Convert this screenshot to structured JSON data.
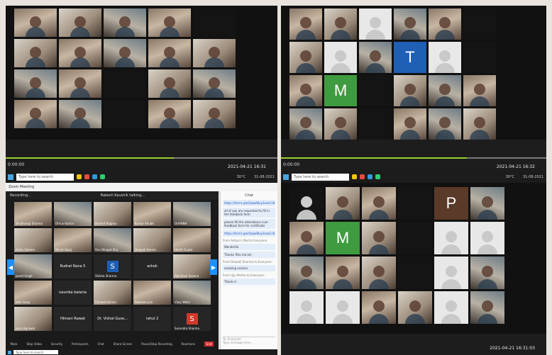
{
  "quad1": {
    "timecode": "0:00:00",
    "stamp": "2021-04-21 16:31",
    "taskbar": {
      "search_placeholder": "Type here to search",
      "clock": "31-08-2021",
      "weather": "30°C"
    }
  },
  "quad2": {
    "timecode": "0:00:00",
    "stamp": "2021-04-21 16:32",
    "taskbar": {
      "search_placeholder": "Type here to search",
      "clock": "31-08-2021",
      "weather": "30°C"
    },
    "letters": [
      "T",
      "M"
    ]
  },
  "quad3": {
    "window_title": "Zoom Meeting",
    "recording": "Recording...",
    "speaker": "Rakesh Kaushik talking...",
    "tiles": [
      {
        "type": "cam",
        "name": "Shubhangi Sharma"
      },
      {
        "type": "cam",
        "name": "Dhruv Kumar"
      },
      {
        "type": "cam",
        "name": "Harshit Raghav"
      },
      {
        "type": "cam",
        "name": "Kumar Shubh"
      },
      {
        "type": "cam",
        "name": "DUANNA"
      },
      {
        "type": "cam",
        "name": "Aisha Saleem"
      },
      {
        "type": "cam",
        "name": "Shruti Bajaj"
      },
      {
        "type": "cam",
        "name": "Dev Bhagat Sha"
      },
      {
        "type": "cam",
        "name": "Deepali Harma"
      },
      {
        "type": "cam",
        "name": "Harsh Gupta"
      },
      {
        "type": "cam",
        "name": "Javed Singh"
      },
      {
        "type": "text",
        "label": "Rudrat Rana 5"
      },
      {
        "type": "letter",
        "letter": "S",
        "color": "#1f5fb4",
        "name": "Shikha Sharma"
      },
      {
        "type": "text",
        "label": "ashok"
      },
      {
        "type": "cam",
        "name": "Abhishek Saxena"
      },
      {
        "type": "cam",
        "name": "Jatin Garg"
      },
      {
        "type": "text",
        "label": "navnika bataria"
      },
      {
        "type": "cam",
        "name": "Chinesh Kumar"
      },
      {
        "type": "cam",
        "name": "Sakshee Jain"
      },
      {
        "type": "cam",
        "name": "Vijay Walla"
      },
      {
        "type": "cam",
        "name": "Janvi Agrawal"
      },
      {
        "type": "text",
        "label": "Himani Rawat"
      },
      {
        "type": "text",
        "label": "Dr. Vishal Guse..."
      },
      {
        "type": "text",
        "label": "rahul 2"
      },
      {
        "type": "letter",
        "letter": "S",
        "color": "#d0392b",
        "name": "Surendra Sharma"
      }
    ],
    "controls": [
      "Mute",
      "Stop Video",
      "Security",
      "Participants",
      "Chat",
      "Share Screen",
      "Pause/Stop Recording",
      "Reactions"
    ],
    "end_label": "End",
    "chat": {
      "title": "Chat",
      "messages": [
        {
          "kind": "link",
          "text": "https://forms.gle/QwjwWuy3saeCn6"
        },
        {
          "kind": "msg",
          "text": "all of you are requested to fill in the feedback form"
        },
        {
          "kind": "msg",
          "text": "please fill this attendance cum feedback form for certificate"
        },
        {
          "kind": "link",
          "text": "https://forms.gle/QwjwWuy3saeCn6"
        },
        {
          "kind": "from",
          "text": "From Aditya's iPad to Everyone:"
        },
        {
          "kind": "msg",
          "text": "Wonderful"
        },
        {
          "kind": "msg",
          "text": "Thanks Ritu ma'am"
        },
        {
          "kind": "from",
          "text": "From Deepali Sharma to Everyone:"
        },
        {
          "kind": "msg",
          "text": "amazing session"
        },
        {
          "kind": "from",
          "text": "From Ujjo Mehta to Everyone:"
        },
        {
          "kind": "msg",
          "text": "Thank-si"
        }
      ],
      "to_label": "To: Everyone",
      "input_placeholder": "Type message here..."
    },
    "taskbar": {
      "search_placeholder": "Type here to search"
    }
  },
  "quad4": {
    "stamp": "2021-04-21 16:31:03",
    "letters": [
      "P",
      "M"
    ]
  }
}
